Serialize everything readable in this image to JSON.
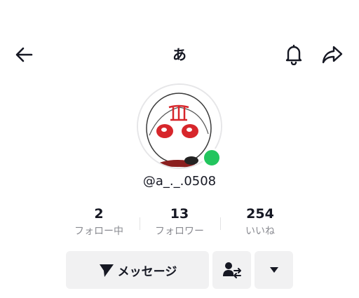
{
  "header": {
    "title": "あ",
    "back_icon": "arrow-left-icon",
    "notify_icon": "bell-icon",
    "share_icon": "share-arrow-icon"
  },
  "profile": {
    "username": "@a_._.0508",
    "online_status_color": "#22c55e"
  },
  "stats": [
    {
      "value": "2",
      "label": "フォロー中"
    },
    {
      "value": "13",
      "label": "フォロワー"
    },
    {
      "value": "254",
      "label": "いいね"
    }
  ],
  "actions": {
    "message_label": "メッセージ",
    "message_icon": "send-icon",
    "follow_icon": "user-swap-icon",
    "more_icon": "caret-down-icon"
  }
}
